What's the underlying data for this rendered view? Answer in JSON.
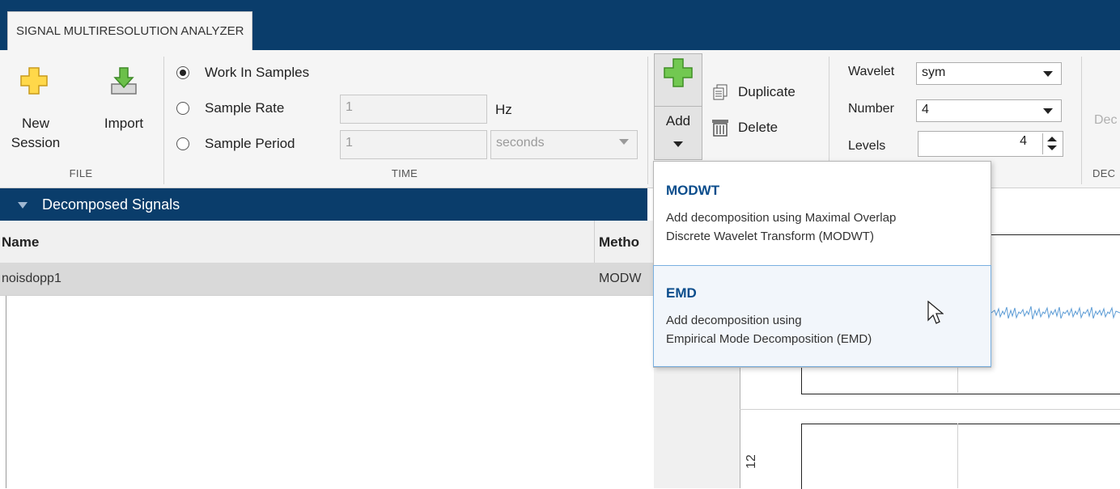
{
  "tab": {
    "title": "SIGNAL MULTIRESOLUTION ANALYZER"
  },
  "file_group": {
    "label": "FILE",
    "new_session_line1": "New",
    "new_session_line2": "Session",
    "import_label": "Import"
  },
  "time_group": {
    "label": "TIME",
    "work_in_samples": "Work In Samples",
    "sample_rate": "Sample Rate",
    "sample_rate_value": "1",
    "sample_rate_unit": "Hz",
    "sample_period": "Sample Period",
    "sample_period_value": "1",
    "period_unit": "seconds"
  },
  "decomp_group": {
    "add_label": "Add",
    "duplicate_label": "Duplicate",
    "delete_label": "Delete",
    "wavelet_label": "Wavelet",
    "wavelet_value": "sym",
    "number_label": "Number",
    "number_value": "4",
    "levels_label": "Levels",
    "levels_value": "4",
    "group_label_partial": "DEC",
    "decompose_partial": "Dec"
  },
  "panel": {
    "title": "Decomposed Signals",
    "col_name": "Name",
    "col_method": "Metho",
    "row_name": "noisdopp1",
    "row_method": "MODW"
  },
  "dropdown": {
    "modwt_title": "MODWT",
    "modwt_desc1": "Add decomposition using Maximal Overlap",
    "modwt_desc2": "Discrete Wavelet Transform (MODWT)",
    "emd_title": "EMD",
    "emd_desc1": "Add decomposition using",
    "emd_desc2": "Empirical Mode Decomposition (EMD)"
  },
  "plot": {
    "axis_label_partial": "12"
  },
  "colors": {
    "header_blue": "#0a3d6b",
    "accent_blue": "#0b4d8c",
    "toolstrip_bg": "#f5f5f5",
    "signal_blue": "#5b9bd5"
  }
}
